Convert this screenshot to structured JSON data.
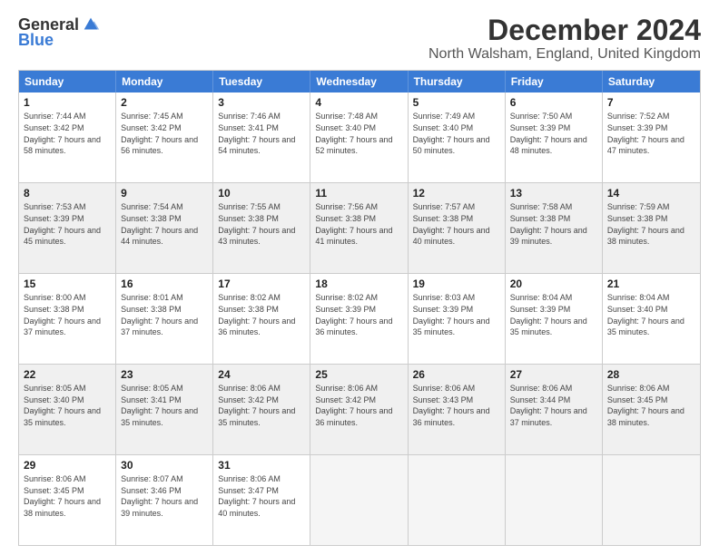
{
  "logo": {
    "general": "General",
    "blue": "Blue"
  },
  "title": "December 2024",
  "subtitle": "North Walsham, England, United Kingdom",
  "headers": [
    "Sunday",
    "Monday",
    "Tuesday",
    "Wednesday",
    "Thursday",
    "Friday",
    "Saturday"
  ],
  "rows": [
    [
      {
        "day": "1",
        "sunrise": "Sunrise: 7:44 AM",
        "sunset": "Sunset: 3:42 PM",
        "daylight": "Daylight: 7 hours and 58 minutes."
      },
      {
        "day": "2",
        "sunrise": "Sunrise: 7:45 AM",
        "sunset": "Sunset: 3:42 PM",
        "daylight": "Daylight: 7 hours and 56 minutes."
      },
      {
        "day": "3",
        "sunrise": "Sunrise: 7:46 AM",
        "sunset": "Sunset: 3:41 PM",
        "daylight": "Daylight: 7 hours and 54 minutes."
      },
      {
        "day": "4",
        "sunrise": "Sunrise: 7:48 AM",
        "sunset": "Sunset: 3:40 PM",
        "daylight": "Daylight: 7 hours and 52 minutes."
      },
      {
        "day": "5",
        "sunrise": "Sunrise: 7:49 AM",
        "sunset": "Sunset: 3:40 PM",
        "daylight": "Daylight: 7 hours and 50 minutes."
      },
      {
        "day": "6",
        "sunrise": "Sunrise: 7:50 AM",
        "sunset": "Sunset: 3:39 PM",
        "daylight": "Daylight: 7 hours and 48 minutes."
      },
      {
        "day": "7",
        "sunrise": "Sunrise: 7:52 AM",
        "sunset": "Sunset: 3:39 PM",
        "daylight": "Daylight: 7 hours and 47 minutes."
      }
    ],
    [
      {
        "day": "8",
        "sunrise": "Sunrise: 7:53 AM",
        "sunset": "Sunset: 3:39 PM",
        "daylight": "Daylight: 7 hours and 45 minutes."
      },
      {
        "day": "9",
        "sunrise": "Sunrise: 7:54 AM",
        "sunset": "Sunset: 3:38 PM",
        "daylight": "Daylight: 7 hours and 44 minutes."
      },
      {
        "day": "10",
        "sunrise": "Sunrise: 7:55 AM",
        "sunset": "Sunset: 3:38 PM",
        "daylight": "Daylight: 7 hours and 43 minutes."
      },
      {
        "day": "11",
        "sunrise": "Sunrise: 7:56 AM",
        "sunset": "Sunset: 3:38 PM",
        "daylight": "Daylight: 7 hours and 41 minutes."
      },
      {
        "day": "12",
        "sunrise": "Sunrise: 7:57 AM",
        "sunset": "Sunset: 3:38 PM",
        "daylight": "Daylight: 7 hours and 40 minutes."
      },
      {
        "day": "13",
        "sunrise": "Sunrise: 7:58 AM",
        "sunset": "Sunset: 3:38 PM",
        "daylight": "Daylight: 7 hours and 39 minutes."
      },
      {
        "day": "14",
        "sunrise": "Sunrise: 7:59 AM",
        "sunset": "Sunset: 3:38 PM",
        "daylight": "Daylight: 7 hours and 38 minutes."
      }
    ],
    [
      {
        "day": "15",
        "sunrise": "Sunrise: 8:00 AM",
        "sunset": "Sunset: 3:38 PM",
        "daylight": "Daylight: 7 hours and 37 minutes."
      },
      {
        "day": "16",
        "sunrise": "Sunrise: 8:01 AM",
        "sunset": "Sunset: 3:38 PM",
        "daylight": "Daylight: 7 hours and 37 minutes."
      },
      {
        "day": "17",
        "sunrise": "Sunrise: 8:02 AM",
        "sunset": "Sunset: 3:38 PM",
        "daylight": "Daylight: 7 hours and 36 minutes."
      },
      {
        "day": "18",
        "sunrise": "Sunrise: 8:02 AM",
        "sunset": "Sunset: 3:39 PM",
        "daylight": "Daylight: 7 hours and 36 minutes."
      },
      {
        "day": "19",
        "sunrise": "Sunrise: 8:03 AM",
        "sunset": "Sunset: 3:39 PM",
        "daylight": "Daylight: 7 hours and 35 minutes."
      },
      {
        "day": "20",
        "sunrise": "Sunrise: 8:04 AM",
        "sunset": "Sunset: 3:39 PM",
        "daylight": "Daylight: 7 hours and 35 minutes."
      },
      {
        "day": "21",
        "sunrise": "Sunrise: 8:04 AM",
        "sunset": "Sunset: 3:40 PM",
        "daylight": "Daylight: 7 hours and 35 minutes."
      }
    ],
    [
      {
        "day": "22",
        "sunrise": "Sunrise: 8:05 AM",
        "sunset": "Sunset: 3:40 PM",
        "daylight": "Daylight: 7 hours and 35 minutes."
      },
      {
        "day": "23",
        "sunrise": "Sunrise: 8:05 AM",
        "sunset": "Sunset: 3:41 PM",
        "daylight": "Daylight: 7 hours and 35 minutes."
      },
      {
        "day": "24",
        "sunrise": "Sunrise: 8:06 AM",
        "sunset": "Sunset: 3:42 PM",
        "daylight": "Daylight: 7 hours and 35 minutes."
      },
      {
        "day": "25",
        "sunrise": "Sunrise: 8:06 AM",
        "sunset": "Sunset: 3:42 PM",
        "daylight": "Daylight: 7 hours and 36 minutes."
      },
      {
        "day": "26",
        "sunrise": "Sunrise: 8:06 AM",
        "sunset": "Sunset: 3:43 PM",
        "daylight": "Daylight: 7 hours and 36 minutes."
      },
      {
        "day": "27",
        "sunrise": "Sunrise: 8:06 AM",
        "sunset": "Sunset: 3:44 PM",
        "daylight": "Daylight: 7 hours and 37 minutes."
      },
      {
        "day": "28",
        "sunrise": "Sunrise: 8:06 AM",
        "sunset": "Sunset: 3:45 PM",
        "daylight": "Daylight: 7 hours and 38 minutes."
      }
    ],
    [
      {
        "day": "29",
        "sunrise": "Sunrise: 8:06 AM",
        "sunset": "Sunset: 3:45 PM",
        "daylight": "Daylight: 7 hours and 38 minutes."
      },
      {
        "day": "30",
        "sunrise": "Sunrise: 8:07 AM",
        "sunset": "Sunset: 3:46 PM",
        "daylight": "Daylight: 7 hours and 39 minutes."
      },
      {
        "day": "31",
        "sunrise": "Sunrise: 8:06 AM",
        "sunset": "Sunset: 3:47 PM",
        "daylight": "Daylight: 7 hours and 40 minutes."
      },
      {
        "day": "",
        "sunrise": "",
        "sunset": "",
        "daylight": ""
      },
      {
        "day": "",
        "sunrise": "",
        "sunset": "",
        "daylight": ""
      },
      {
        "day": "",
        "sunrise": "",
        "sunset": "",
        "daylight": ""
      },
      {
        "day": "",
        "sunrise": "",
        "sunset": "",
        "daylight": ""
      }
    ]
  ]
}
